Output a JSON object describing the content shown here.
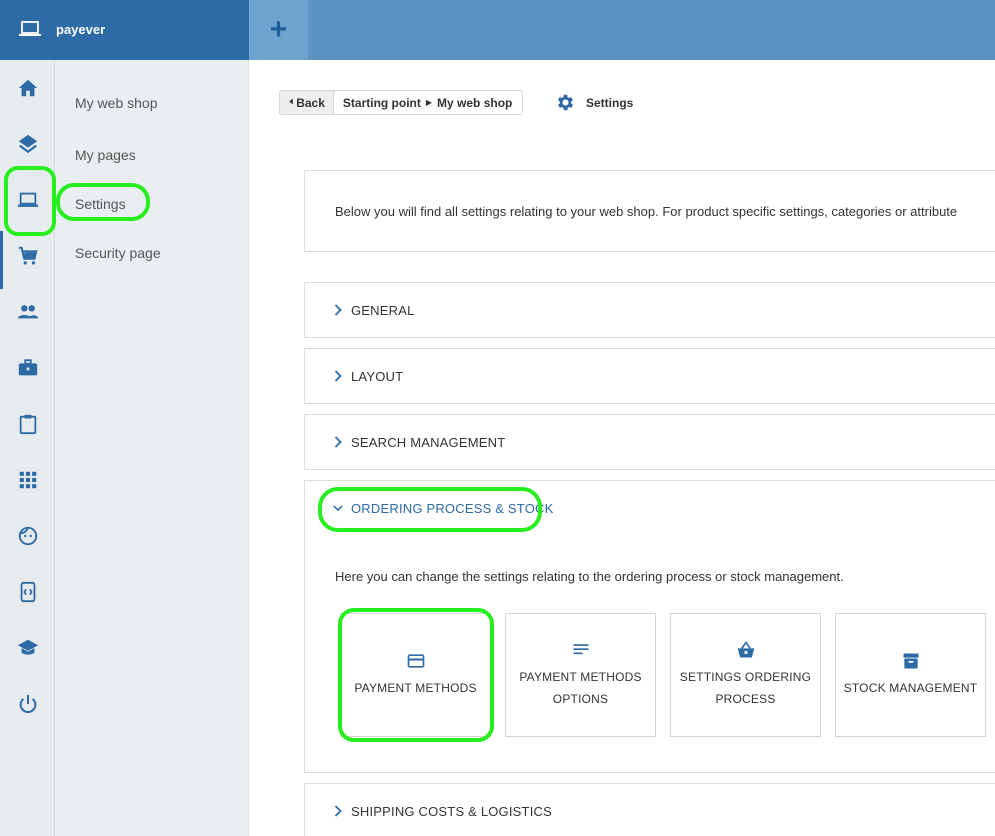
{
  "header": {
    "brand_name": "payever",
    "add_label": "+"
  },
  "rail": {
    "items": [
      "home-icon",
      "layers-icon",
      "laptop-icon",
      "cart-icon",
      "people-icon",
      "briefcase-icon",
      "clipboard-icon",
      "apps-grid-icon",
      "face-icon",
      "code-device-icon",
      "graduation-cap-icon",
      "power-icon"
    ],
    "active": "laptop-icon"
  },
  "subnav": {
    "items": [
      {
        "label": "My web shop"
      },
      {
        "label": "My pages"
      },
      {
        "label": "Settings"
      },
      {
        "label": "Security page"
      }
    ]
  },
  "breadcrumb": {
    "back_label": "Back",
    "crumb_1": "Starting point",
    "crumb_2": "My web shop",
    "current": "Settings"
  },
  "intro_text": "Below you will find all settings relating to your web shop. For product specific settings, categories or attribute",
  "sections": [
    {
      "label": "GENERAL"
    },
    {
      "label": "LAYOUT"
    },
    {
      "label": "SEARCH MANAGEMENT"
    },
    {
      "label": "ORDERING PROCESS & STOCK"
    },
    {
      "label": "SHIPPING COSTS & LOGISTICS"
    }
  ],
  "ordering": {
    "description": "Here you can change the settings relating to the ordering process or stock management.",
    "cards": [
      {
        "line1": "PAYMENT METHODS",
        "line2": ""
      },
      {
        "line1": "PAYMENT METHODS",
        "line2": "OPTIONS"
      },
      {
        "line1": "SETTINGS ORDERING",
        "line2": "PROCESS"
      },
      {
        "line1": "STOCK MANAGEMENT",
        "line2": ""
      }
    ]
  },
  "colors": {
    "brand_dark": "#2d6aa6",
    "topbar": "#5b93c1",
    "highlight": "#27ee1f"
  }
}
